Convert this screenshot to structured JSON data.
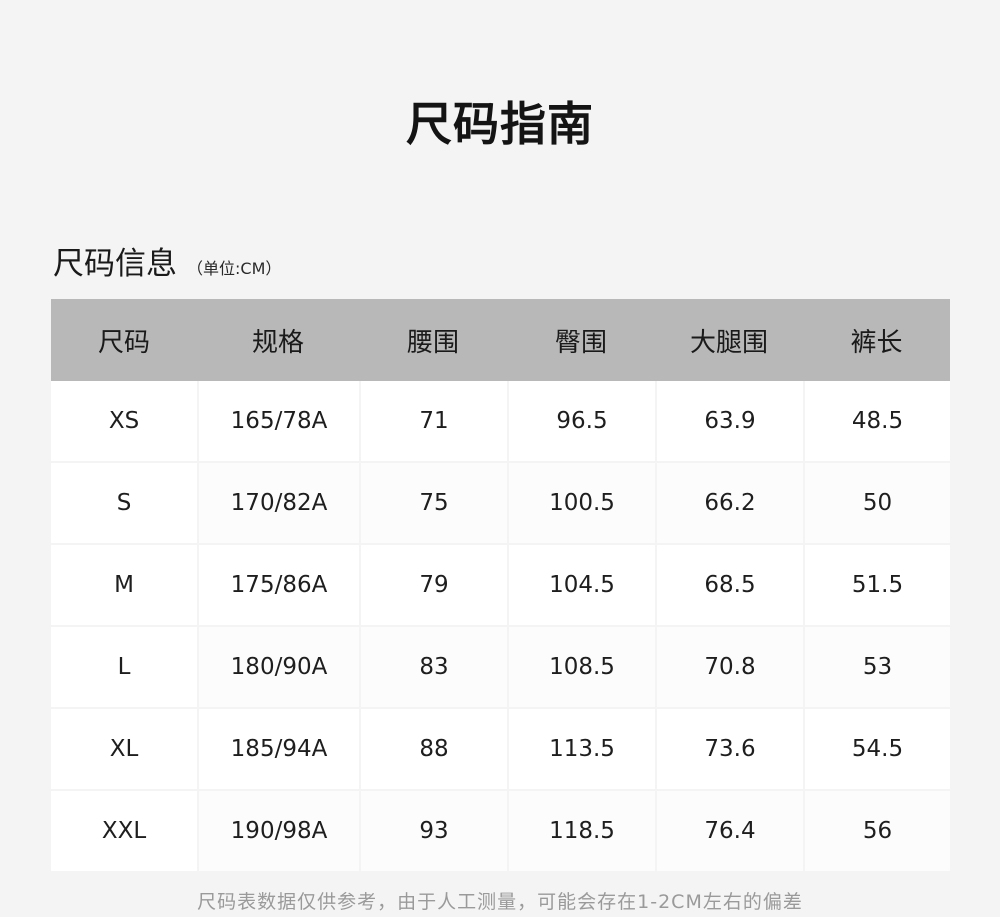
{
  "page": {
    "title": "尺码指南"
  },
  "section": {
    "title": "尺码信息",
    "unit": "（单位:CM）"
  },
  "table": {
    "headers": [
      "尺码",
      "规格",
      "腰围",
      "臀围",
      "大腿围",
      "裤长"
    ],
    "rows": [
      [
        "XS",
        "165/78A",
        "71",
        "96.5",
        "63.9",
        "48.5"
      ],
      [
        "S",
        "170/82A",
        "75",
        "100.5",
        "66.2",
        "50"
      ],
      [
        "M",
        "175/86A",
        "79",
        "104.5",
        "68.5",
        "51.5"
      ],
      [
        "L",
        "180/90A",
        "83",
        "108.5",
        "70.8",
        "53"
      ],
      [
        "XL",
        "185/94A",
        "88",
        "113.5",
        "73.6",
        "54.5"
      ],
      [
        "XXL",
        "190/98A",
        "93",
        "118.5",
        "76.4",
        "56"
      ]
    ]
  },
  "footnote": "尺码表数据仅供参考，由于人工测量，可能会存在1-2CM左右的偏差",
  "colors": {
    "background": "#f4f4f4",
    "header_bg": "#b8b8b8",
    "cell_bg": "#ffffff",
    "text": "#1a1a1a",
    "footnote_text": "#9a9a9a"
  }
}
